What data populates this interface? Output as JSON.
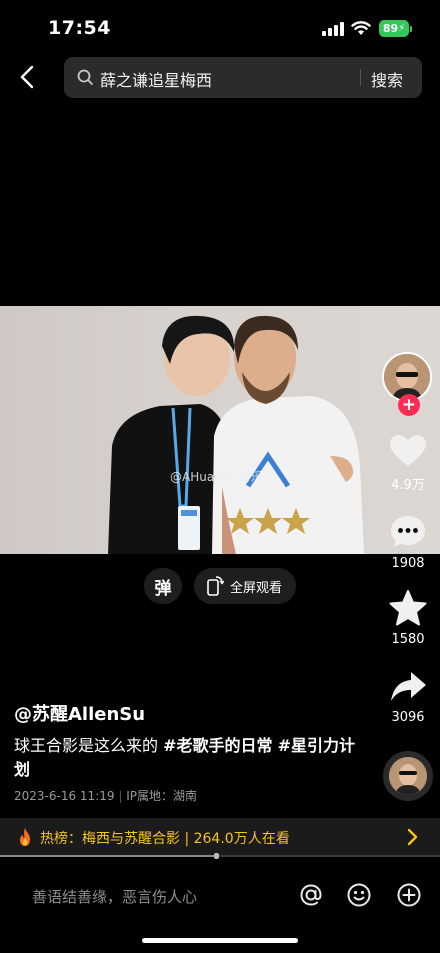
{
  "status_bar": {
    "time": "17:54",
    "battery": "89"
  },
  "search": {
    "query": "薛之谦追星梅西",
    "button_label": "搜索"
  },
  "video": {
    "watermark": "@AHuangi_可乐"
  },
  "controls": {
    "danmaku_label": "弹",
    "fullscreen_label": "全屏观看"
  },
  "actions": {
    "likes": "4.9万",
    "comments": "1908",
    "favorites": "1580",
    "shares": "3096"
  },
  "post": {
    "author": "@苏醒AllenSu",
    "caption_text": "球王合影是这么来的 ",
    "tags": [
      "#老歌手的日常",
      "#星引力计划"
    ],
    "date": "2023-6-16 11:19",
    "location": "IP属地：湖南"
  },
  "hot": {
    "label": "热榜：梅西与苏醒合影 | 264.0万人在看"
  },
  "playback": {
    "progress": 0.49
  },
  "comment_bar": {
    "placeholder": "善语结善缘，恶言伤人心"
  },
  "colors": {
    "like_accent": "#fe2c55",
    "hot_text": "#f5c518",
    "battery": "#34c759"
  }
}
